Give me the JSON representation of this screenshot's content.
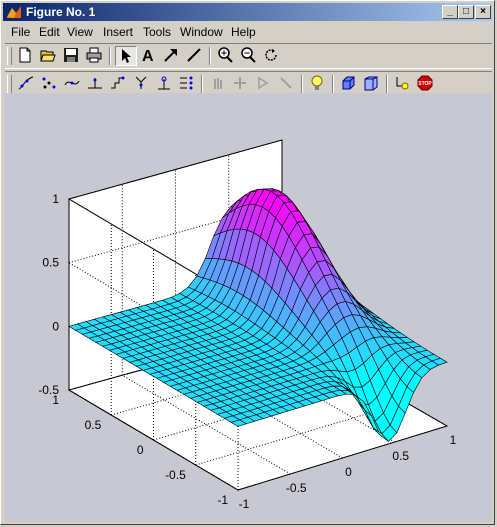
{
  "window": {
    "title": "Figure No. 1",
    "min_label": "_",
    "max_label": "□",
    "close_label": "×"
  },
  "menu": [
    "File",
    "Edit",
    "View",
    "Insert",
    "Tools",
    "Window",
    "Help"
  ],
  "menu_accel": [
    "F",
    "E",
    "V",
    "I",
    "T",
    "W",
    "H"
  ],
  "toolbar1": [
    "new-figure",
    "open-file",
    "save",
    "print",
    "edit-plot",
    "insert-text",
    "insert-arrow",
    "insert-line",
    "zoom-in",
    "zoom-out",
    "rotate-3d"
  ],
  "toolbar2": [
    "data-statistics",
    "basic-fitting",
    "curve-tool-1",
    "curve-tool-2",
    "curve-tool-3",
    "curve-tool-4",
    "curve-tool-5",
    "curve-tool-6",
    "disabled-1",
    "disabled-2",
    "disabled-3",
    "disabled-4",
    "light-bulb",
    "camera-orbit",
    "camera-projection",
    "scene-light",
    "stop"
  ],
  "chart_data": {
    "type": "surface",
    "title": "",
    "x_range": [
      -1,
      1
    ],
    "y_range": [
      -1,
      1
    ],
    "z_range": [
      -0.5,
      1
    ],
    "x_ticks": [
      "-1",
      "-0.5",
      "0",
      "0.5",
      "1"
    ],
    "y_ticks": [
      "-1",
      "-0.5",
      "0",
      "0.5",
      "1"
    ],
    "z_ticks": [
      "-0.5",
      "0",
      "0.5",
      "1"
    ],
    "grid": true,
    "colormap": "cool",
    "colormap_colors": [
      "#00ffff",
      "#ff00ff"
    ],
    "grid_size": 25,
    "function": "x * exp(-x^2 - y^2) style surface: flat zero plane on one side, peak ~0.9 near x≈0.5, trough ~-0.5"
  }
}
